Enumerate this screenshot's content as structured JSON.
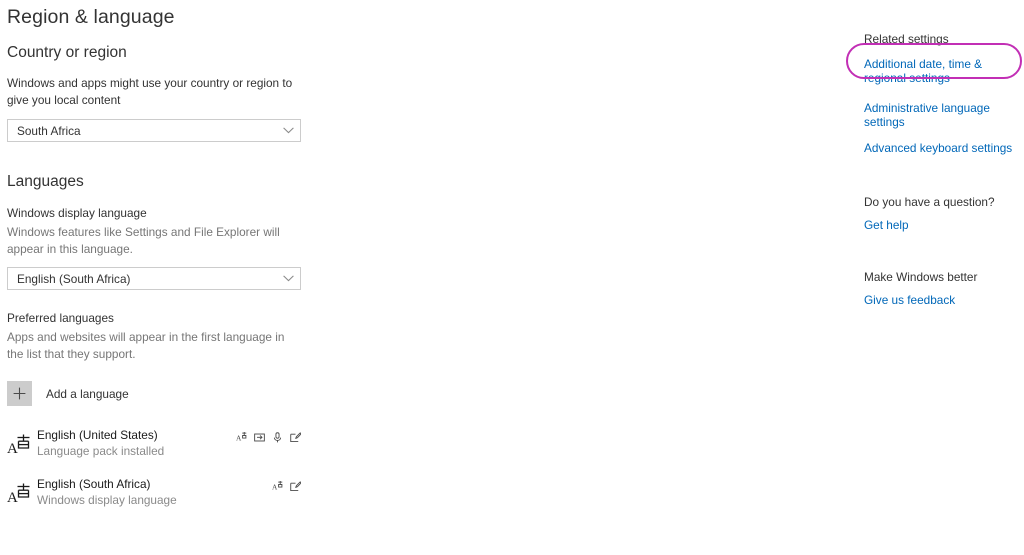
{
  "page": {
    "title": "Region & language"
  },
  "country_section": {
    "heading": "Country or region",
    "description": "Windows and apps might use your country or region to give you local content",
    "dropdown": {
      "name": "country-or-region-dropdown",
      "value": "South Africa",
      "chevron_icon": "chevron-down-icon"
    }
  },
  "languages_section": {
    "heading": "Languages",
    "display_language": {
      "label": "Windows display language",
      "description": "Windows features like Settings and File Explorer will appear in this language.",
      "dropdown": {
        "name": "windows-display-language-dropdown",
        "value": "English (South Africa)",
        "chevron_icon": "chevron-down-icon"
      }
    },
    "preferred": {
      "label": "Preferred languages",
      "description": "Apps and websites will appear in the first language in the list that they support.",
      "add_button": {
        "label": "Add a language",
        "icon": "plus-icon"
      },
      "items": [
        {
          "name": "English (United States)",
          "status": "Language pack installed",
          "glyph_icon": "language-icon",
          "feature_icons": [
            "keyboard-icon",
            "handwriting-icon",
            "speech-icon",
            "pen-input-icon"
          ]
        },
        {
          "name": "English (South Africa)",
          "status": "Windows display language",
          "glyph_icon": "language-icon",
          "feature_icons": [
            "keyboard-icon",
            "pen-input-icon"
          ]
        }
      ]
    }
  },
  "related_settings": {
    "heading": "Related settings",
    "links": [
      "Additional date, time & regional settings",
      "Administrative language settings",
      "Advanced keyboard settings"
    ]
  },
  "help_section": {
    "heading": "Do you have a question?",
    "link": "Get help"
  },
  "feedback_section": {
    "heading": "Make Windows better",
    "link": "Give us feedback"
  },
  "annotation": {
    "shape": "ellipse-highlight",
    "color": "#c22fb5",
    "targets": "Additional date, time & regional settings"
  },
  "colors": {
    "link": "#0067b8",
    "text": "#333333",
    "muted": "#767676",
    "annotation": "#c22fb5",
    "combo_border": "#cccccc",
    "button_fill": "#cccccc"
  }
}
